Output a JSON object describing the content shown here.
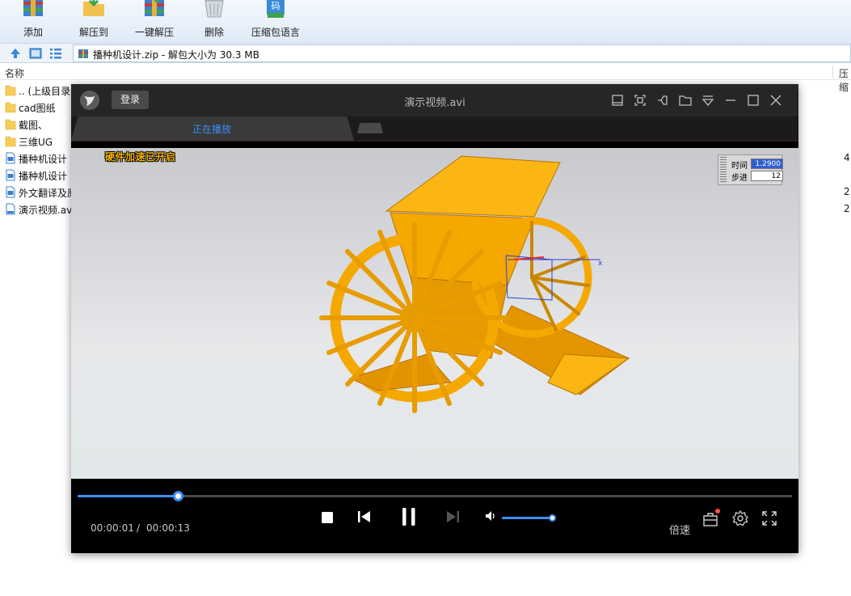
{
  "toolbar": {
    "add": "添加",
    "extract_to": "解压到",
    "one_click_extract": "一键解压",
    "delete": "删除",
    "archive_language": "压缩包语言"
  },
  "address": {
    "path": "播种机设计.zip - 解包大小为 30.3 MB"
  },
  "columns": {
    "name": "名称",
    "packed": "压缩"
  },
  "files": [
    {
      "name": ".. (上级目录)",
      "type": "folder",
      "size": ""
    },
    {
      "name": "cad图纸",
      "type": "folder",
      "size": ""
    },
    {
      "name": "截图、",
      "type": "folder",
      "size": ""
    },
    {
      "name": "三维UG",
      "type": "folder",
      "size": ""
    },
    {
      "name": "播种机设计",
      "type": "doc",
      "size": "4"
    },
    {
      "name": "播种机设计",
      "type": "doc",
      "size": ""
    },
    {
      "name": "外文翻译及原",
      "type": "doc",
      "size": "2"
    },
    {
      "name": "演示视频.avi",
      "type": "avi",
      "size": "2"
    }
  ],
  "player": {
    "login": "登录",
    "filename": "演示视频.avi",
    "tab_playing": "正在播放",
    "hw_accel": "硬件加速已开启",
    "sim_time_label": "时间",
    "sim_time_value": "1.2900",
    "sim_step_label": "步进",
    "sim_step_value": "12",
    "current_time": "00:00:01",
    "separator": "/",
    "total_time": "00:00:13",
    "progress_fraction": 0.14,
    "volume_fraction": 1.0,
    "speed_label": "倍速"
  },
  "colors": {
    "accent": "#3c8ff5",
    "machine": "#f5a800",
    "folder": "#f6cd57"
  }
}
